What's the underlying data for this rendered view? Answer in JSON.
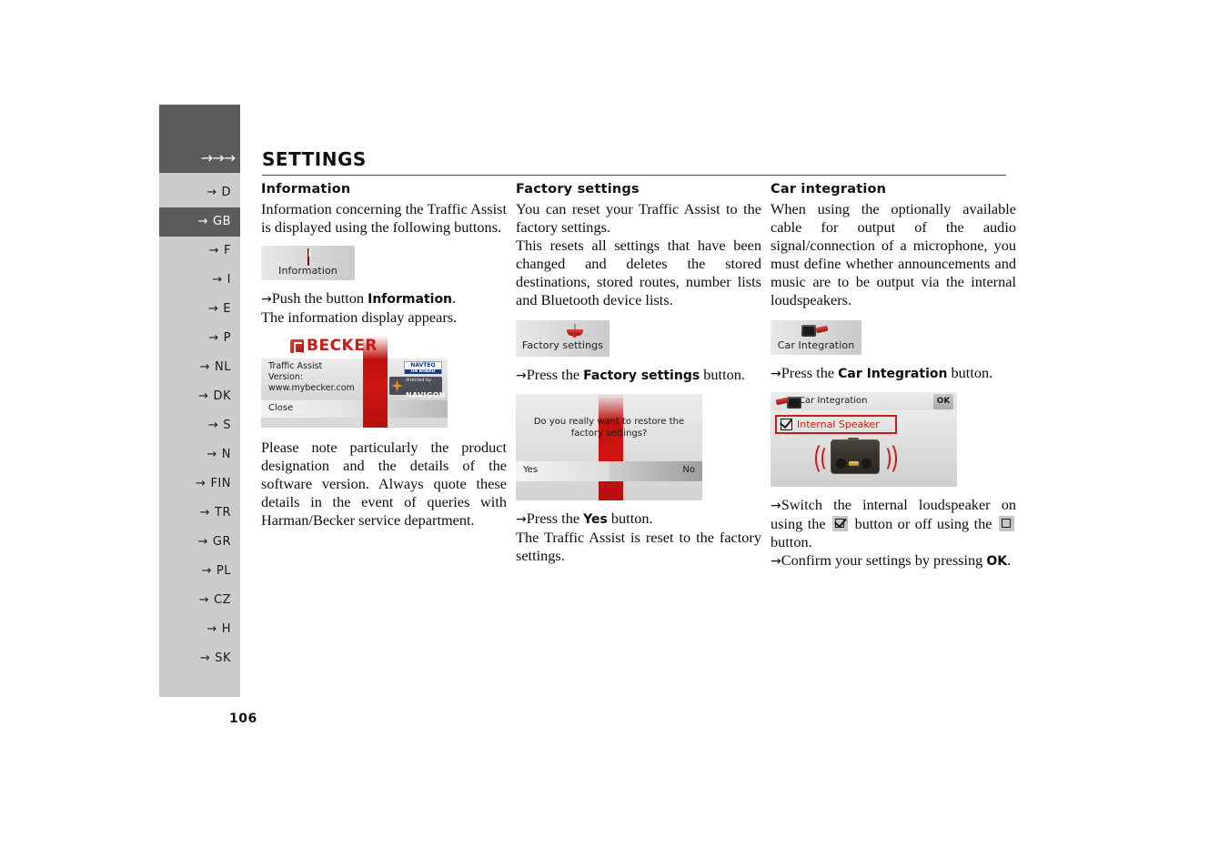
{
  "document": {
    "title": "SETTINGS",
    "page_number": "106",
    "nav_arrows": "→→→"
  },
  "sidebar": {
    "items": [
      {
        "label": "D",
        "active": false
      },
      {
        "label": "GB",
        "active": true
      },
      {
        "label": "F",
        "active": false
      },
      {
        "label": "I",
        "active": false
      },
      {
        "label": "E",
        "active": false
      },
      {
        "label": "P",
        "active": false
      },
      {
        "label": "NL",
        "active": false
      },
      {
        "label": "DK",
        "active": false
      },
      {
        "label": "S",
        "active": false
      },
      {
        "label": "N",
        "active": false
      },
      {
        "label": "FIN",
        "active": false
      },
      {
        "label": "TR",
        "active": false
      },
      {
        "label": "GR",
        "active": false
      },
      {
        "label": "PL",
        "active": false
      },
      {
        "label": "CZ",
        "active": false
      },
      {
        "label": "H",
        "active": false
      },
      {
        "label": "SK",
        "active": false
      }
    ],
    "arrow_glyph": "→"
  },
  "columns": {
    "information": {
      "heading": "Information",
      "intro": "Information concerning the Traffic Assist is displayed using the following buttons.",
      "button": {
        "label": "Information",
        "icon": "info-icon"
      },
      "step_arrow": "→",
      "step_prefix": "Push the button ",
      "step_bold": "Information",
      "step_suffix": ".",
      "step_note": "The information display appears.",
      "screen": {
        "brand": "BECKER",
        "line1": "Traffic Assist",
        "line2": "Version:",
        "line3": "www.mybecker.com",
        "close_label": "Close",
        "badge_navteq_top": "NAVTEQ",
        "badge_navteq_bottom": "ON BOARD",
        "badge_navigon_top": "directed by",
        "badge_navigon_bottom": "NAVIGON"
      },
      "outro": "Please note particularly the product designation and the details of the software version. Always quote these details in the event of queries with Harman/Becker service department."
    },
    "factory": {
      "heading": "Factory settings",
      "para1": "You can reset your Traffic Assist to the factory settings.",
      "para2": "This resets all settings that have been changed and deletes the stored destinations, stored routes, number lists and Bluetooth device lists.",
      "button": {
        "label": "Factory settings",
        "icon": "factory-settings-icon"
      },
      "step_arrow": "→",
      "step1_prefix": "Press the ",
      "step1_bold": "Factory settings",
      "step1_suffix": " button.",
      "screen": {
        "question": "Do you really want to restore the factory settings?",
        "yes_label": "Yes",
        "no_label": "No"
      },
      "step2_prefix": "Press the ",
      "step2_bold": "Yes",
      "step2_suffix": " button.",
      "step2_note": "The Traffic Assist is reset to the factory settings."
    },
    "car": {
      "heading": "Car integration",
      "intro": "When using the optionally available cable for output of the audio signal/connection of a microphone, you must define whether announcements and music are to be output via the internal loudspeakers.",
      "button": {
        "label": "Car Integration",
        "icon": "car-integration-icon"
      },
      "step_arrow": "→",
      "step1_prefix": "Press the ",
      "step1_bold": "Car Integration",
      "step1_suffix": " button.",
      "screen": {
        "title": "Car Integration",
        "ok_label": "OK",
        "checkbox_label": "Internal Speaker",
        "checkbox_checked": true
      },
      "step2_a": "Switch the internal loudspeaker on using the ",
      "step2_b": " button or off using the ",
      "step2_c": " button.",
      "step3_prefix": "Confirm your settings by pressing ",
      "step3_bold": "OK",
      "step3_suffix": "."
    }
  },
  "colors": {
    "accent_red": "#cc1a16",
    "sidebar_bg": "#cccccc",
    "sidebar_active": "#5b5b5b",
    "header_block": "#5b5b5b"
  }
}
